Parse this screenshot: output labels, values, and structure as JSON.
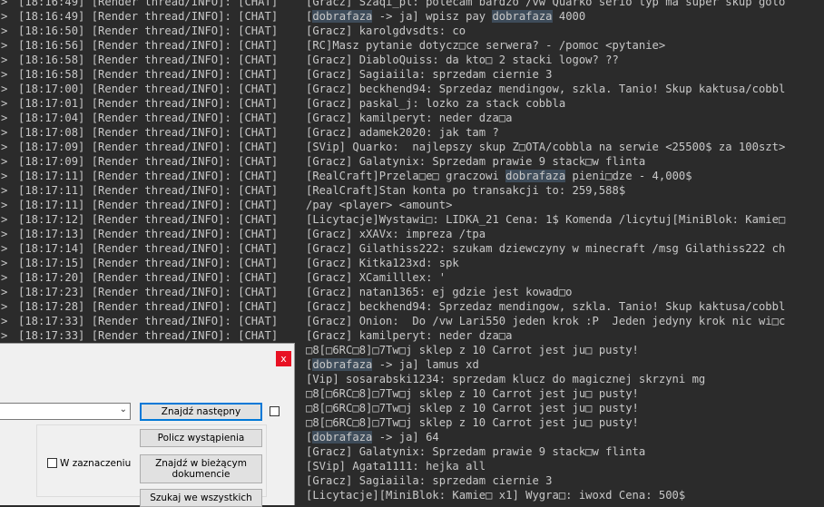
{
  "log": {
    "lines": [
      {
        "arrow": ">",
        "prefix": "[18:16:49] [Render thread/INFO]: [CHAT]",
        "msg": [
          {
            "t": "[Gracz] Szaqi_pl: polecam bardzo /vw Quarko serio typ ma super skup golo"
          }
        ]
      },
      {
        "arrow": ">",
        "prefix": "[18:16:49] [Render thread/INFO]: [CHAT]",
        "msg": [
          {
            "t": "dobrafaza",
            "hl": true
          },
          {
            "t": " -> ja] wpisz pay "
          },
          {
            "t": "dobrafaza",
            "hl": true
          },
          {
            "t": " 4000"
          }
        ],
        "lead": "["
      },
      {
        "arrow": ">",
        "prefix": "[18:16:50] [Render thread/INFO]: [CHAT]",
        "msg": [
          {
            "t": "[Gracz] karolgdvsdts: co"
          }
        ]
      },
      {
        "arrow": ">",
        "prefix": "[18:16:56] [Render thread/INFO]: [CHAT]",
        "msg": [
          {
            "t": "[RC]Masz pytanie dotycz□ce serwera? - /pomoc <pytanie>"
          }
        ]
      },
      {
        "arrow": ">",
        "prefix": "[18:16:58] [Render thread/INFO]: [CHAT]",
        "msg": [
          {
            "t": "[Gracz] DiabloQuiss: da kto□ 2 stacki logow? ??"
          }
        ]
      },
      {
        "arrow": ">",
        "prefix": "[18:16:58] [Render thread/INFO]: [CHAT]",
        "msg": [
          {
            "t": "[Gracz] Sagiaiila: sprzedam ciernie 3"
          }
        ]
      },
      {
        "arrow": ">",
        "prefix": "[18:17:00] [Render thread/INFO]: [CHAT]",
        "msg": [
          {
            "t": "[Gracz] beckhend94: Sprzedaz mendingow, szkla. Tanio! Skup kaktusa/cobbl"
          }
        ]
      },
      {
        "arrow": ">",
        "prefix": "[18:17:01] [Render thread/INFO]: [CHAT]",
        "msg": [
          {
            "t": "[Gracz] paskal_j: lozko za stack cobbla"
          }
        ]
      },
      {
        "arrow": ">",
        "prefix": "[18:17:04] [Render thread/INFO]: [CHAT]",
        "msg": [
          {
            "t": "[Gracz] kamilperyt: neder dza□a"
          }
        ]
      },
      {
        "arrow": ">",
        "prefix": "[18:17:08] [Render thread/INFO]: [CHAT]",
        "msg": [
          {
            "t": "[Gracz] adamek2020: jak tam ?"
          }
        ]
      },
      {
        "arrow": ">",
        "prefix": "[18:17:09] [Render thread/INFO]: [CHAT]",
        "msg": [
          {
            "t": "[SVip] Quarko:  najlepszy skup Z□OTA/cobbla na serwie <25500$ za 100szt>"
          }
        ]
      },
      {
        "arrow": ">",
        "prefix": "[18:17:09] [Render thread/INFO]: [CHAT]",
        "msg": [
          {
            "t": "[Gracz] Galatynix: Sprzedam prawie 9 stack□w flinta"
          }
        ]
      },
      {
        "arrow": ">",
        "prefix": "[18:17:11] [Render thread/INFO]: [CHAT]",
        "msg": [
          {
            "t": "[RealCraft]Przela□e□ graczowi "
          },
          {
            "t": "dobrafaza",
            "hl": true
          },
          {
            "t": " pieni□dze - 4,000$"
          }
        ]
      },
      {
        "arrow": ">",
        "prefix": "[18:17:11] [Render thread/INFO]: [CHAT]",
        "msg": [
          {
            "t": "[RealCraft]Stan konta po transakcji to: 259,588$"
          }
        ]
      },
      {
        "arrow": ">",
        "prefix": "[18:17:11] [Render thread/INFO]: [CHAT]",
        "msg": [
          {
            "t": "/pay <player> <amount>"
          }
        ]
      },
      {
        "arrow": ">",
        "prefix": "[18:17:12] [Render thread/INFO]: [CHAT]",
        "msg": [
          {
            "t": "[Licytacje]Wystawi□: LIDKA_21 Cena: 1$ Komenda /licytuj[MiniBlok: Kamie□"
          }
        ]
      },
      {
        "arrow": ">",
        "prefix": "[18:17:13] [Render thread/INFO]: [CHAT]",
        "msg": [
          {
            "t": "[Gracz] xXAVx: impreza /tpa"
          }
        ]
      },
      {
        "arrow": ">",
        "prefix": "[18:17:14] [Render thread/INFO]: [CHAT]",
        "msg": [
          {
            "t": "[Gracz] Gilathiss222: szukam dziewczyny w minecraft /msg Gilathiss222 ch"
          }
        ]
      },
      {
        "arrow": ">",
        "prefix": "[18:17:15] [Render thread/INFO]: [CHAT]",
        "msg": [
          {
            "t": "[Gracz] Kitka123xd: spk"
          }
        ]
      },
      {
        "arrow": ">",
        "prefix": "[18:17:20] [Render thread/INFO]: [CHAT]",
        "msg": [
          {
            "t": "[Gracz] XCamilllex: '"
          }
        ]
      },
      {
        "arrow": ">",
        "prefix": "[18:17:23] [Render thread/INFO]: [CHAT]",
        "msg": [
          {
            "t": "[Gracz] natan1365: ej gdzie jest kowad□o"
          }
        ]
      },
      {
        "arrow": ">",
        "prefix": "[18:17:28] [Render thread/INFO]: [CHAT]",
        "msg": [
          {
            "t": "[Gracz] beckhend94: Sprzedaz mendingow, szkla. Tanio! Skup kaktusa/cobbl"
          }
        ]
      },
      {
        "arrow": ">",
        "prefix": "[18:17:33] [Render thread/INFO]: [CHAT]",
        "msg": [
          {
            "t": "[Gracz] Onion:  Do /vw Lari550 jeden krok :P  Jeden jedyny krok nic wi□c"
          }
        ]
      },
      {
        "arrow": ">",
        "prefix": "[18:17:33] [Render thread/INFO]: [CHAT]",
        "msg": [
          {
            "t": "[Gracz] kamilperyt: neder dza□a"
          }
        ]
      },
      {
        "arrow": "",
        "prefix": "",
        "msg": [
          {
            "t": "□8[□6RC□8]□7Tw□j sklep z 10 Carrot jest ju□ pusty!"
          }
        ]
      },
      {
        "arrow": "",
        "prefix": "",
        "msg": [
          {
            "t": "["
          },
          {
            "t": "dobrafaza",
            "hl": true
          },
          {
            "t": " -> ja] lamus xd"
          }
        ]
      },
      {
        "arrow": "",
        "prefix": "",
        "msg": [
          {
            "t": "[Vip] sosarabski1234: sprzedam klucz do magicznej skrzyni mg"
          }
        ]
      },
      {
        "arrow": "",
        "prefix": "",
        "msg": [
          {
            "t": "□8[□6RC□8]□7Tw□j sklep z 10 Carrot jest ju□ pusty!"
          }
        ]
      },
      {
        "arrow": "",
        "prefix": "",
        "msg": [
          {
            "t": "□8[□6RC□8]□7Tw□j sklep z 10 Carrot jest ju□ pusty!"
          }
        ]
      },
      {
        "arrow": "",
        "prefix": "",
        "msg": [
          {
            "t": "□8[□6RC□8]□7Tw□j sklep z 10 Carrot jest ju□ pusty!"
          }
        ]
      },
      {
        "arrow": "",
        "prefix": "",
        "msg": [
          {
            "t": "["
          },
          {
            "t": "dobrafaza",
            "hl": true
          },
          {
            "t": " -> ja] 64"
          }
        ]
      },
      {
        "arrow": "",
        "prefix": "",
        "msg": [
          {
            "t": "[Gracz] Galatynix: Sprzedam prawie 9 stack□w flinta"
          }
        ]
      },
      {
        "arrow": "",
        "prefix": "",
        "msg": [
          {
            "t": "[SVip] Agata1111: hejka all"
          }
        ]
      },
      {
        "arrow": "",
        "prefix": "",
        "msg": [
          {
            "t": "[Gracz] Sagiaiila: sprzedam ciernie 3"
          }
        ]
      },
      {
        "arrow": "",
        "prefix": "",
        "msg": [
          {
            "t": "[Licytacje][MiniBlok: Kamie□ x1] Wygra□: iwoxd Cena: 500$"
          }
        ]
      }
    ]
  },
  "find_dialog": {
    "close_label": "x",
    "search_value": "",
    "find_next_label": "Znajdź następny",
    "count_label": "Policz wystąpienia",
    "in_selection_label": "W zaznaczeniu",
    "find_in_current_label": "Znajdź w bieżącym dokumencie",
    "find_all_label": "Szukaj we wszystkich"
  },
  "colors": {
    "log_bg": "#2b2b2b",
    "log_text": "#c8c8c8",
    "highlight": "#3e4c5a",
    "close_red": "#e81123"
  }
}
